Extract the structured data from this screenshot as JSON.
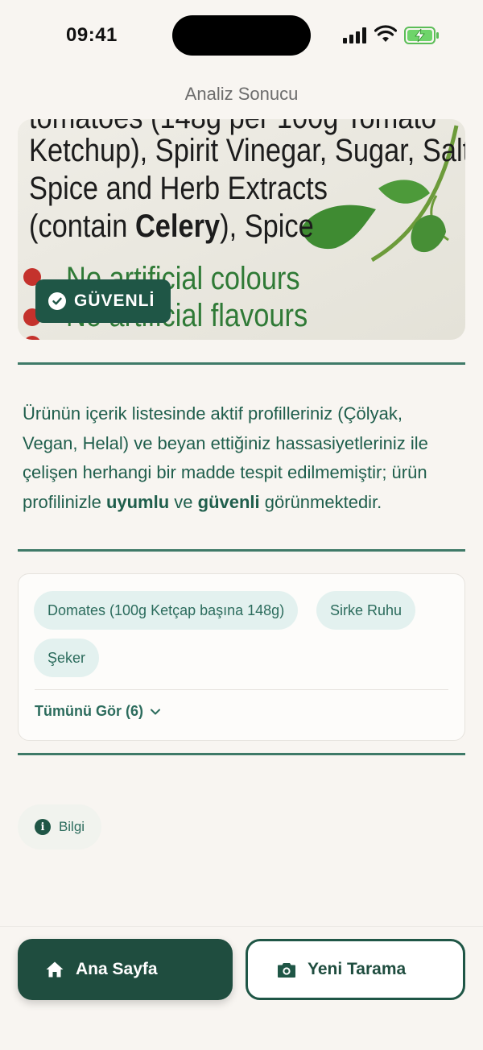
{
  "status_bar": {
    "time": "09:41"
  },
  "screen": {
    "title": "Analiz Sonucu"
  },
  "photo": {
    "lines": [
      "Ketchup), Spirit Vinegar, Sugar, Salt,",
      "Spice and Herb Extracts",
      "(contain ",
      "Celery",
      "), Spice",
      "No artificial colours",
      "No artificial flavours"
    ]
  },
  "badge": {
    "label": "GÜVENLİ",
    "icon": "check-circle-icon"
  },
  "summary": {
    "part1": "Ürünün içerik listesinde aktif profilleriniz (Çölyak, Vegan, Helal) ve beyan ettiğiniz hassasiyetleriniz ile çelişen herhangi bir madde tespit edilmemiştir; ürün profilinizle ",
    "bold1": "uyumlu",
    "part2": " ve ",
    "bold2": "güvenli",
    "part3": " görünmektedir."
  },
  "ingredients": {
    "chips": [
      "Domates (100g Ketçap başına 148g)",
      "Sirke Ruhu",
      "Şeker"
    ],
    "see_all": "Tümünü Gör (6)"
  },
  "info": {
    "label": "Bilgi",
    "icon": "info-icon"
  },
  "nav": {
    "home_label": "Ana Sayfa",
    "scan_label": "Yeni Tarama"
  },
  "colors": {
    "accent": "#1f5646",
    "chip_bg": "#e3f1ef",
    "background": "#f8f5f1"
  }
}
